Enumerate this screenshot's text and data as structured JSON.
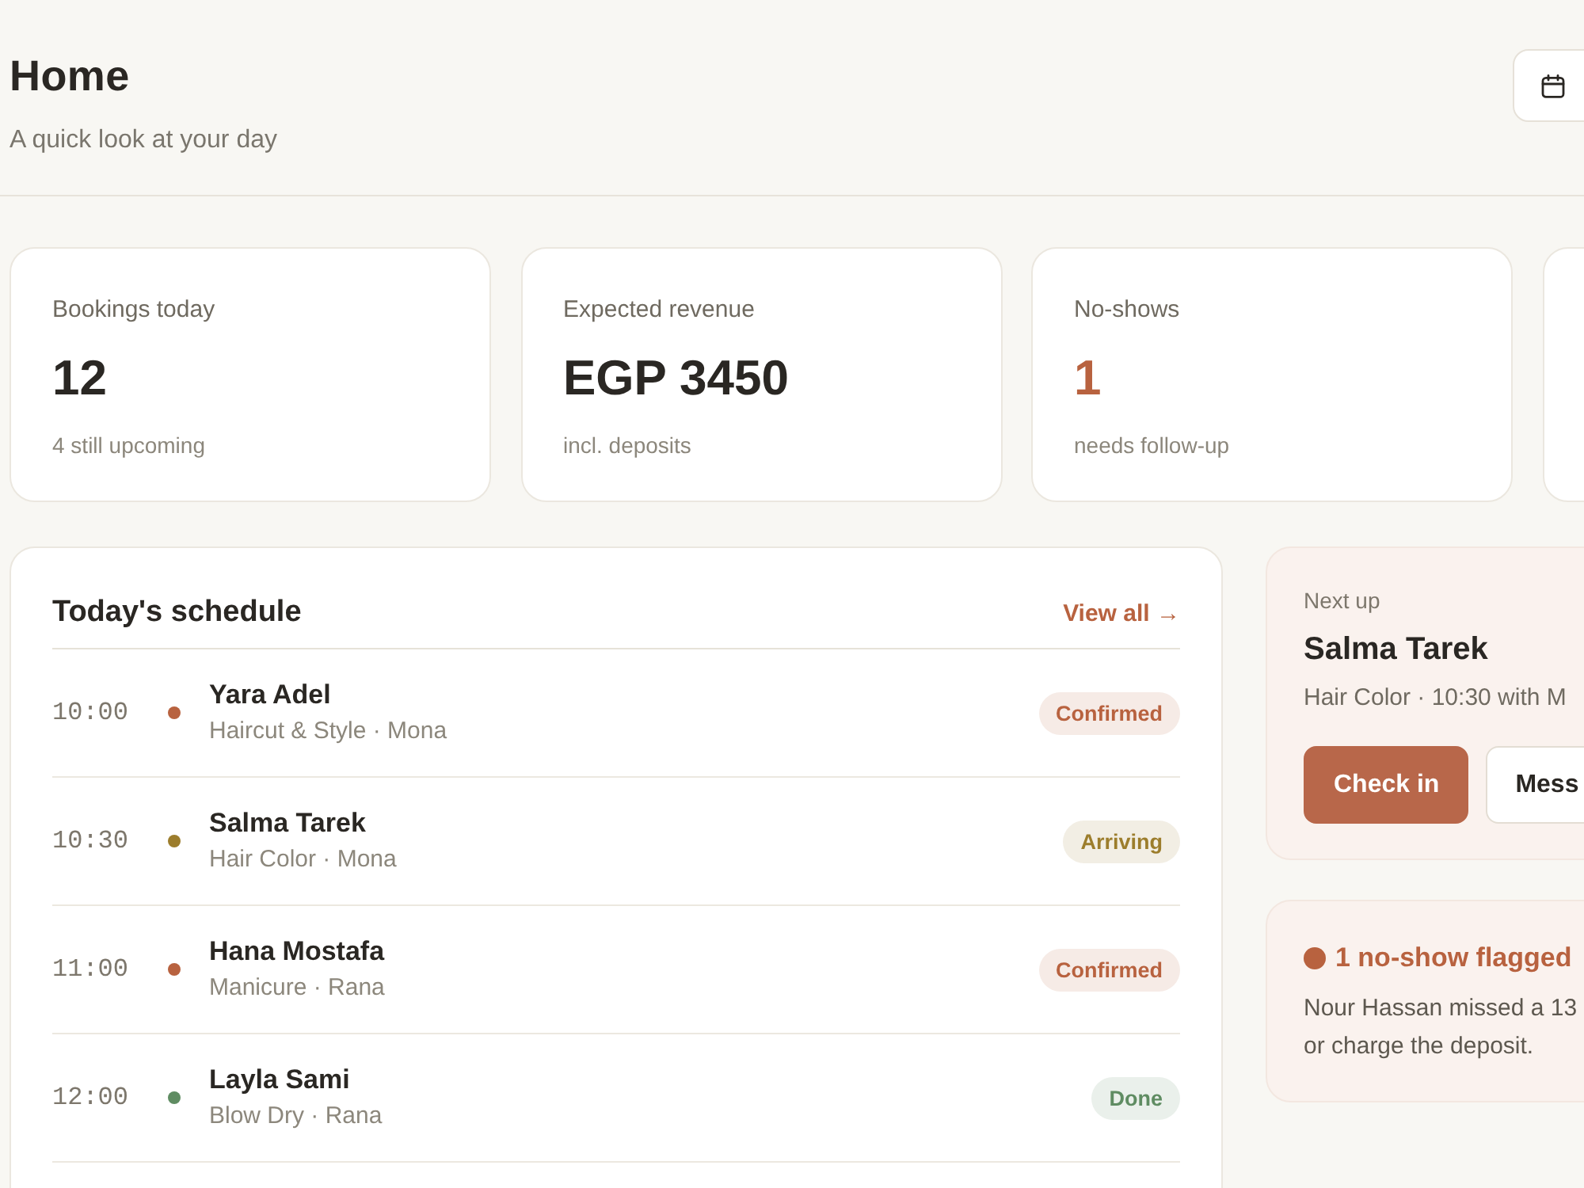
{
  "header": {
    "title": "Home",
    "subtitle": "A quick look at your day"
  },
  "stats": [
    {
      "label": "Bookings today",
      "value": "12",
      "note": "4 still upcoming",
      "accent": false
    },
    {
      "label": "Expected revenue",
      "value": "EGP 3450",
      "note": "incl. deposits",
      "accent": false
    },
    {
      "label": "No-shows",
      "value": "1",
      "note": "needs follow-up",
      "accent": true
    }
  ],
  "schedule": {
    "title": "Today's schedule",
    "link": "View all →",
    "appointments": [
      {
        "time": "10:00",
        "name": "Yara Adel",
        "detail": "Haircut & Style · Mona",
        "status": "Confirmed",
        "color": "#b8623f"
      },
      {
        "time": "10:30",
        "name": "Salma Tarek",
        "detail": "Hair Color · Mona",
        "status": "Arriving",
        "color": "#9c7d2c"
      },
      {
        "time": "11:00",
        "name": "Hana Mostafa",
        "detail": "Manicure · Rana",
        "status": "Confirmed",
        "color": "#b8623f"
      },
      {
        "time": "12:00",
        "name": "Layla Sami",
        "detail": "Blow Dry · Rana",
        "status": "Done",
        "color": "#5f8c62"
      }
    ]
  },
  "next_up": {
    "label": "Next up",
    "name": "Salma Tarek",
    "detail": "Hair Color · 10:30 with M",
    "buttons": [
      {
        "label": "Check in",
        "primary": true
      },
      {
        "label": "Mess",
        "primary": false
      }
    ]
  },
  "alert": {
    "title": "1 no-show flagged",
    "lines": [
      "Nour Hassan missed a 13",
      "or charge the deposit."
    ]
  }
}
